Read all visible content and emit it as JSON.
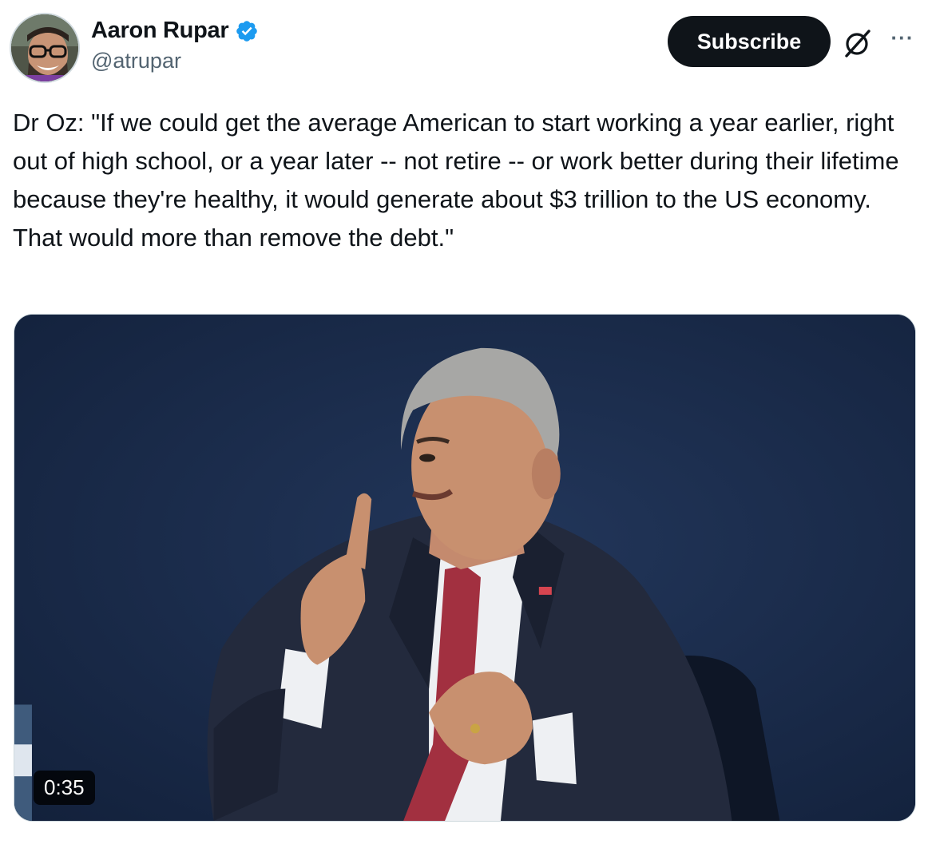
{
  "author": {
    "name": "Aaron Rupar",
    "handle": "@atrupar",
    "verified": true,
    "verified_icon": "verified-badge-icon",
    "avatar": "avatar-photo"
  },
  "actions": {
    "subscribe_label": "Subscribe",
    "grok_icon": "grok-icon",
    "more_icon": "more-options-icon"
  },
  "tweet": {
    "text": "Dr Oz: \"If we could get the average American to start working a year earlier, right out of high school, or a year later -- not retire -- or work better during their lifetime because they're healthy, it would generate about $3 trillion to the US economy. That would more than remove the debt.\""
  },
  "media": {
    "type": "video",
    "duration": "0:35",
    "thumbnail": "man-in-suit-speaking-video-thumbnail"
  },
  "colors": {
    "text": "#0f1419",
    "secondary": "#536471",
    "verified": "#1d9bf0",
    "button_bg": "#0f1419",
    "button_text": "#ffffff"
  }
}
